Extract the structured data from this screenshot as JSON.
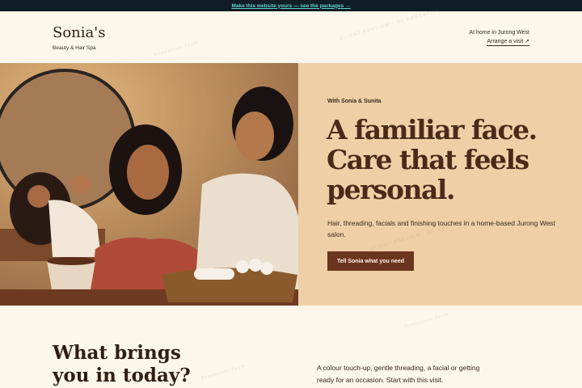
{
  "announcement": {
    "label": "Make this website yours — see the packages →"
  },
  "header": {
    "brand_name": "Sonia's",
    "brand_sub": "Beauty & Hair Spa",
    "location": "At home in Jurong West",
    "visit_link": "Arrange a visit ↗"
  },
  "hero": {
    "eyebrow": "With Sonia & Sunita",
    "headline_lines": [
      "A familiar face.",
      "Care that feels",
      "personal."
    ],
    "lead": "Hair, threading, facials and finishing touches in a home-based Jurong West salon.",
    "cta_label": "Tell Sonia what you need"
  },
  "section": {
    "title_lines": [
      "What brings",
      "you in today?"
    ],
    "text": "A colour touch-up, gentle threading, a facial or getting ready for an occasion. Start with this visit."
  },
  "watermark": {
    "brand": "Kreeative Tech",
    "note": "CLIENT PREVIEW · BY KREEATIVE"
  }
}
